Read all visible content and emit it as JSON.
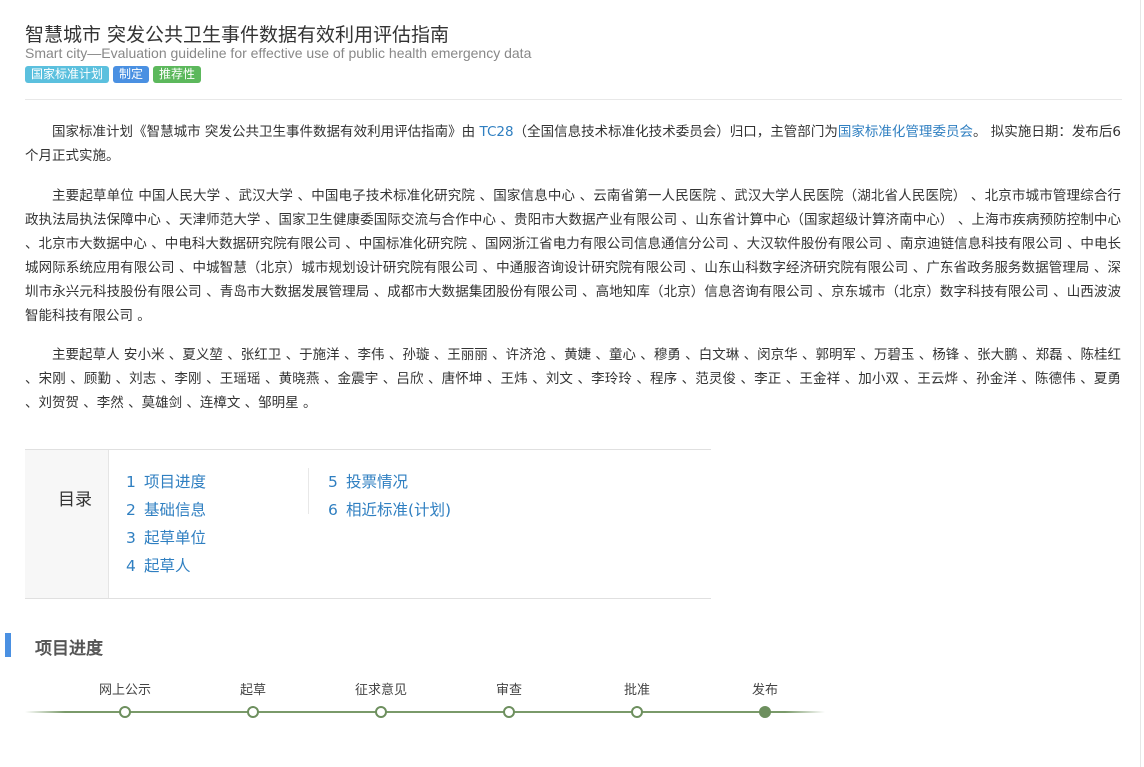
{
  "header": {
    "title": "智慧城市 突发公共卫生事件数据有效利用评估指南",
    "subtitle": "Smart city—Evaluation guideline for effective use of public health emergency data",
    "tags": [
      "国家标准计划",
      "制定",
      "推荐性"
    ]
  },
  "intro": {
    "p1_before": "国家标准计划《智慧城市 突发公共卫生事件数据有效利用评估指南》由 ",
    "tc_link": "TC28",
    "p1_middle": "（全国信息技术标准化技术委员会）归口，主管部门为",
    "dept_link": "国家标准化管理委员会",
    "p1_after": "。 拟实施日期：发布后6个月正式实施。",
    "p2": "主要起草单位 中国人民大学 、武汉大学 、中国电子技术标准化研究院 、国家信息中心 、云南省第一人民医院 、武汉大学人民医院（湖北省人民医院） 、北京市城市管理综合行政执法局执法保障中心 、天津师范大学 、国家卫生健康委国际交流与合作中心 、贵阳市大数据产业有限公司 、山东省计算中心（国家超级计算济南中心） 、上海市疾病预防控制中心 、北京市大数据中心 、中电科大数据研究院有限公司 、中国标准化研究院 、国网浙江省电力有限公司信息通信分公司 、大汉软件股份有限公司 、南京迪链信息科技有限公司 、中电长城网际系统应用有限公司 、中城智慧（北京）城市规划设计研究院有限公司 、中通服咨询设计研究院有限公司 、山东山科数字经济研究院有限公司 、广东省政务服务数据管理局 、深圳市永兴元科技股份有限公司 、青岛市大数据发展管理局 、成都市大数据集团股份有限公司 、高地知库（北京）信息咨询有限公司 、京东城市（北京）数字科技有限公司 、山西波波智能科技有限公司 。",
    "p3": "主要起草人 安小米 、夏义堃 、张红卫 、于施洋 、李伟 、孙璇 、王丽丽 、许济沧 、黄婕 、童心 、穆勇 、白文琳 、闵京华 、郭明军 、万碧玉 、杨锋 、张大鹏 、郑磊 、陈桂红 、宋刚 、顾勤 、刘志 、李刚 、王瑶瑶 、黄晓燕 、金震宇 、吕欣 、唐怀坤 、王炜 、刘文 、李玲玲 、程序 、范灵俊 、李正 、王金祥 、加小双 、王云烨 、孙金洋 、陈德伟 、夏勇 、刘贺贺 、李然 、莫雄剑 、连樟文 、邹明星 。"
  },
  "toc": {
    "label": "目录",
    "items": [
      {
        "num": "1",
        "text": "项目进度"
      },
      {
        "num": "2",
        "text": "基础信息"
      },
      {
        "num": "3",
        "text": "起草单位"
      },
      {
        "num": "4",
        "text": "起草人"
      },
      {
        "num": "5",
        "text": "投票情况"
      },
      {
        "num": "6",
        "text": "相近标准(计划)"
      }
    ]
  },
  "progress": {
    "title": "项目进度",
    "steps": [
      "网上公示",
      "起草",
      "征求意见",
      "审查",
      "批准",
      "发布"
    ],
    "current_step": 5,
    "colors": {
      "line": "#7a9a6a",
      "dot": "#6d8f5e",
      "accent": "#4a90e2"
    }
  }
}
